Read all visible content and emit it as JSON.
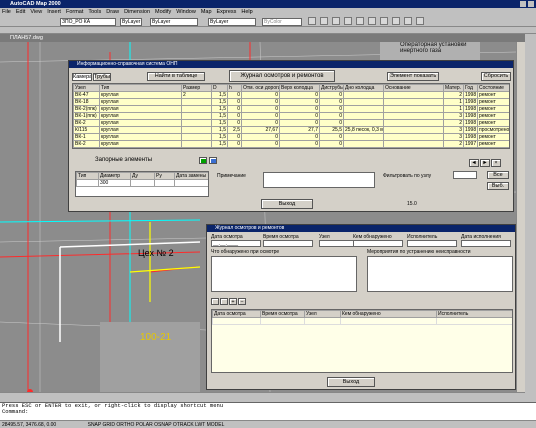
{
  "app": {
    "title": "AutoCAD Map 2000",
    "menu": [
      "File",
      "Edit",
      "View",
      "Insert",
      "Format",
      "Tools",
      "Draw",
      "Dimension",
      "Modify",
      "Window",
      "Map",
      "Express",
      "Help"
    ],
    "layer_combo": "ЗПО_РО КА",
    "color_combo": "ByLayer",
    "linetype_combo": "ByLayer",
    "lineweight_combo": "ByLayer",
    "plotstyle_combo": "ByColor",
    "drawing_title": "ПЛАН57.dwg"
  },
  "drawing": {
    "label_workshop": "Цех № 2",
    "label_building": "Операторная установки инертного газа",
    "label_zone": "100-21"
  },
  "win1": {
    "title": "Информационно-справочная система ОНП",
    "tab_inspection": "Камера",
    "tab_pipes": "Трубы",
    "btn_find": "Найти в таблице",
    "btn_journal": "Журнал осмотров и ремонтов",
    "btn_show_element": "Элемент показать",
    "btn_reset": "Сбросить",
    "columns": [
      "Узел",
      "Тип",
      "Размер",
      "D",
      "h",
      "Отм. оси дороги",
      "Верх колодца",
      "Диструбы",
      "Дно колодца",
      "Основание",
      "Матер.",
      "Год",
      "Состояние"
    ],
    "rows": [
      [
        "ВК-47",
        "круглая",
        "2",
        "1,5",
        "0",
        "0",
        "0",
        "0",
        "",
        "",
        "2",
        "1998",
        "ремонт"
      ],
      [
        "ВК-18",
        "круглая",
        "",
        "1,5",
        "0",
        "0",
        "0",
        "0",
        "",
        "",
        "1",
        "1998",
        "ремонт"
      ],
      [
        "ВК-2(ппк)",
        "круглая",
        "",
        "1,5",
        "0",
        "0",
        "0",
        "0",
        "",
        "",
        "1",
        "1998",
        "ремонт"
      ],
      [
        "ВК-1(ппк)",
        "круглая",
        "",
        "1,5",
        "0",
        "0",
        "0",
        "0",
        "",
        "",
        "3",
        "1998",
        "ремонт"
      ],
      [
        "ВК-2",
        "круглая",
        "",
        "1,5",
        "0",
        "0",
        "0",
        "0",
        "",
        "",
        "2",
        "1998",
        "ремонт"
      ],
      [
        "К/115",
        "круглая",
        "",
        "1,5",
        "2,5",
        "27,67",
        "27,7",
        "25,5",
        "25,8 песок, 0,3 метра",
        "",
        "3",
        "1998",
        "просмотрено"
      ],
      [
        "ВК-1",
        "круглая",
        "",
        "1,5",
        "0",
        "0",
        "0",
        "0",
        "",
        "",
        "3",
        "1998",
        "ремонт"
      ],
      [
        "ВК-2",
        "круглая",
        "",
        "1,5",
        "0",
        "0",
        "0",
        "0",
        "",
        "",
        "2",
        "1997",
        "ремонт"
      ]
    ],
    "shutoff_title": "Запорные элементы",
    "shutoff_columns": [
      "Тип",
      "Диаметр",
      "Ду",
      "Ру",
      "Дата замены"
    ],
    "shutoff_value": "300",
    "label_notes": "Примечание",
    "label_filter": "Фильтровать по узлу",
    "btn_all": "Все",
    "btn_select": "Выб.",
    "btn_exit": "Выход",
    "status_num": "15.0"
  },
  "win2": {
    "title": "Журнал осмотров и ремонтов",
    "header_labels": [
      "Дата осмотра",
      "Время осмотра",
      "Узел",
      "Кем обнаружено",
      "Исполнитель",
      "Дата исполнения"
    ],
    "header_values": [
      "__.__.____",
      "",
      "",
      "",
      "",
      ""
    ],
    "label_found": "Что обнаружено при осмотре",
    "label_done": "Мероприятия по устранению неисправности",
    "grid_columns": [
      "Дата осмотра",
      "Время осмотра",
      "Узел",
      "Кем обнаружено",
      "Исполнитель"
    ],
    "btn_exit": "Выход"
  },
  "cmd": {
    "line1": "Press ESC or ENTER to exit, or right-click to display shortcut menu",
    "line2": "Command:"
  },
  "status": {
    "coords": "28495.57, 3476.68, 0.00",
    "modes": "SNAP GRID ORTHO POLAR OSNAP OTRACK LWT MODEL"
  },
  "colors": {
    "title_blue": "#0a246a",
    "grid_yellow": "#ffffc8",
    "drawing_bg": "#8c8c8c"
  }
}
